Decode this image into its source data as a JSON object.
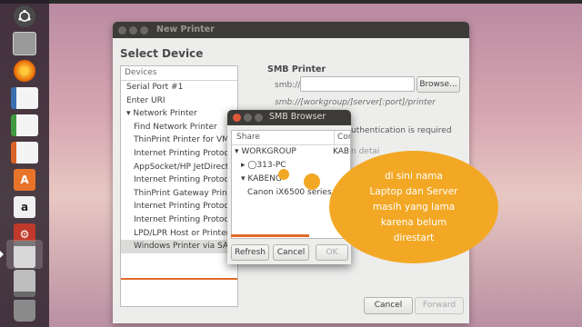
{
  "launcher": {
    "items": [
      {
        "icon": "ubuntu-dash-icon",
        "color": "#3b3b3b"
      },
      {
        "icon": "files-icon",
        "color": "#8a8a8a"
      },
      {
        "icon": "firefox-icon",
        "color": "#e66000"
      },
      {
        "icon": "writer-icon",
        "color": "#3a6fb0"
      },
      {
        "icon": "calc-icon",
        "color": "#3f9a3f"
      },
      {
        "icon": "impress-icon",
        "color": "#d9642a"
      },
      {
        "icon": "software-center-icon",
        "color": "#e8742a"
      },
      {
        "icon": "amazon-icon",
        "color": "#f0f0f0"
      },
      {
        "icon": "settings-icon",
        "color": "#c0392b"
      },
      {
        "icon": "printer-icon",
        "color": "#7a7a7a"
      },
      {
        "icon": "drive-icon",
        "color": "#6a6a6a"
      },
      {
        "icon": "trash-icon",
        "color": "#5a5a5a"
      }
    ]
  },
  "dialog": {
    "title": "New Printer",
    "heading": "Select Device",
    "devices_header": "Devices",
    "devices": [
      {
        "label": "Serial Port #1",
        "sub": false
      },
      {
        "label": "Enter URI",
        "sub": false
      },
      {
        "label": "▾ Network Printer",
        "sub": false
      },
      {
        "label": "Find Network Printer",
        "sub": true
      },
      {
        "label": "ThinPrint Printer for VMw",
        "sub": true
      },
      {
        "label": "Internet Printing Protoco",
        "sub": true
      },
      {
        "label": "AppSocket/HP JetDirect",
        "sub": true
      },
      {
        "label": "Internet Printing Protoco",
        "sub": true
      },
      {
        "label": "ThinPrint Gateway Printer",
        "sub": true
      },
      {
        "label": "Internet Printing Protoco",
        "sub": true
      },
      {
        "label": "Internet Printing Protoco",
        "sub": true
      },
      {
        "label": "LPD/LPR Host or Printer",
        "sub": true
      },
      {
        "label": "Windows Printer via SAM",
        "sub": true,
        "selected": true
      }
    ],
    "smb_label": "SMB Printer",
    "smb_prefix": "smb://",
    "smb_value": "",
    "browse": "Browse...",
    "smb_hint": "smb://[workgroup/]server[:port]/printer",
    "auth_text": "uthentication is required",
    "auth_text2": "n detai",
    "cancel": "Cancel",
    "forward": "Forward"
  },
  "smb_browser": {
    "title": "SMB Browser",
    "col_share": "Share",
    "col_comment": "Comr",
    "rows": [
      {
        "label": "▾ WORKGROUP",
        "indent": 0,
        "comment": "KABE"
      },
      {
        "label": "▸ ◯313-PC",
        "indent": 1,
        "comment": ""
      },
      {
        "label": "▾ KABENG",
        "indent": 1,
        "comment": ""
      },
      {
        "label": "Canon iX6500 series",
        "indent": 2,
        "comment": ""
      }
    ],
    "refresh": "Refresh",
    "cancel": "Cancel",
    "ok": "OK"
  },
  "callout": {
    "text": "di sini nama\nLaptop dan Server\nmasih yang lama\nkarena belum\ndirestart",
    "color": "#f3a825"
  }
}
